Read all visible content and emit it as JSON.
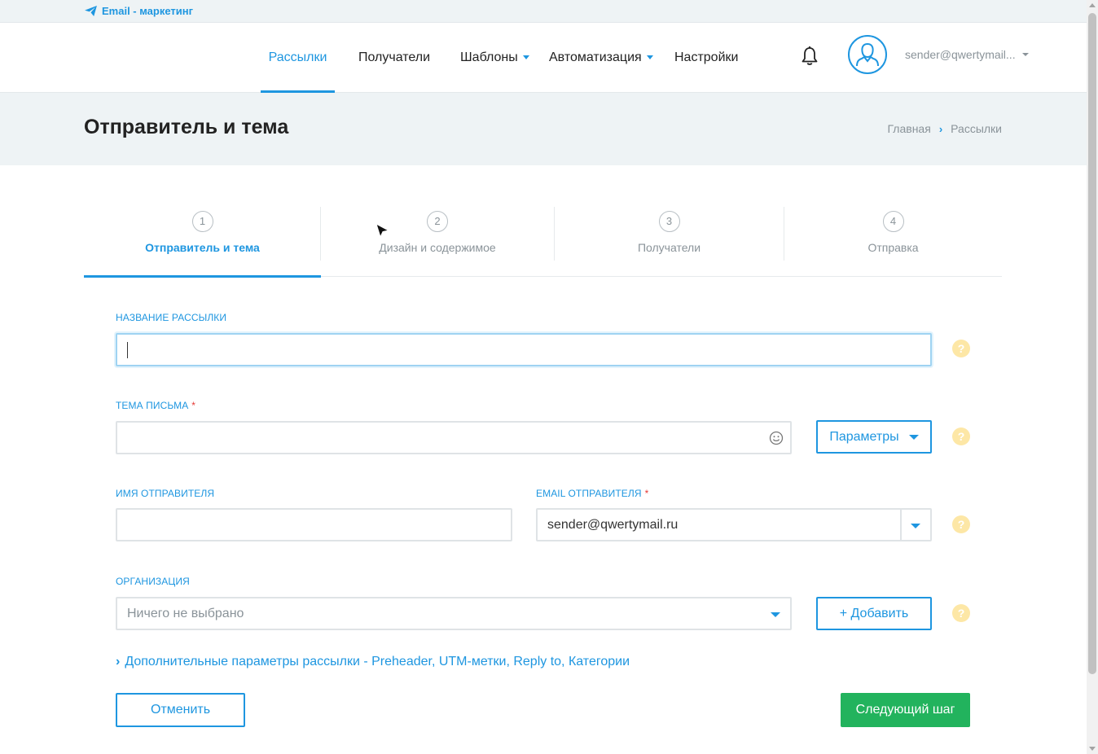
{
  "topbar": {
    "brand": "Email - маркетинг"
  },
  "nav": {
    "items": [
      {
        "label": "Рассылки",
        "active": true,
        "dropdown": false
      },
      {
        "label": "Получатели",
        "active": false,
        "dropdown": false
      },
      {
        "label": "Шаблоны",
        "active": false,
        "dropdown": true
      },
      {
        "label": "Автоматизация",
        "active": false,
        "dropdown": true
      },
      {
        "label": "Настройки",
        "active": false,
        "dropdown": false
      }
    ],
    "user_email": "sender@qwertymail..."
  },
  "header": {
    "title": "Отправитель и тема",
    "breadcrumb": [
      "Главная",
      "Рассылки"
    ]
  },
  "steps": [
    {
      "num": "1",
      "label": "Отправитель и тема",
      "active": true
    },
    {
      "num": "2",
      "label": "Дизайн и содержимое",
      "active": false
    },
    {
      "num": "3",
      "label": "Получатели",
      "active": false
    },
    {
      "num": "4",
      "label": "Отправка",
      "active": false
    }
  ],
  "form": {
    "campaign_name": {
      "label": "НАЗВАНИЕ РАССЫЛКИ",
      "value": ""
    },
    "subject": {
      "label": "ТЕМА ПИСЬМА",
      "required": "*",
      "value": "",
      "params_button": "Параметры"
    },
    "sender_name": {
      "label": "ИМЯ ОТПРАВИТЕЛЯ",
      "value": ""
    },
    "sender_email": {
      "label": "EMAIL ОТПРАВИТЕЛЯ",
      "required": "*",
      "value": "sender@qwertymail.ru"
    },
    "organization": {
      "label": "ОРГАНИЗАЦИЯ",
      "placeholder": "Ничего не выбрано",
      "add_button": "+ Добавить"
    },
    "help_glyph": "?",
    "extra_link": "Дополнительные параметры рассылки - Preheader, UTM-метки, Reply to, Категории"
  },
  "actions": {
    "cancel": "Отменить",
    "next": "Следующий шаг"
  },
  "colors": {
    "accent": "#1e96e0",
    "success": "#22b35d",
    "help": "#fde7a6",
    "required": "#e53935",
    "band": "#eef3f5"
  }
}
